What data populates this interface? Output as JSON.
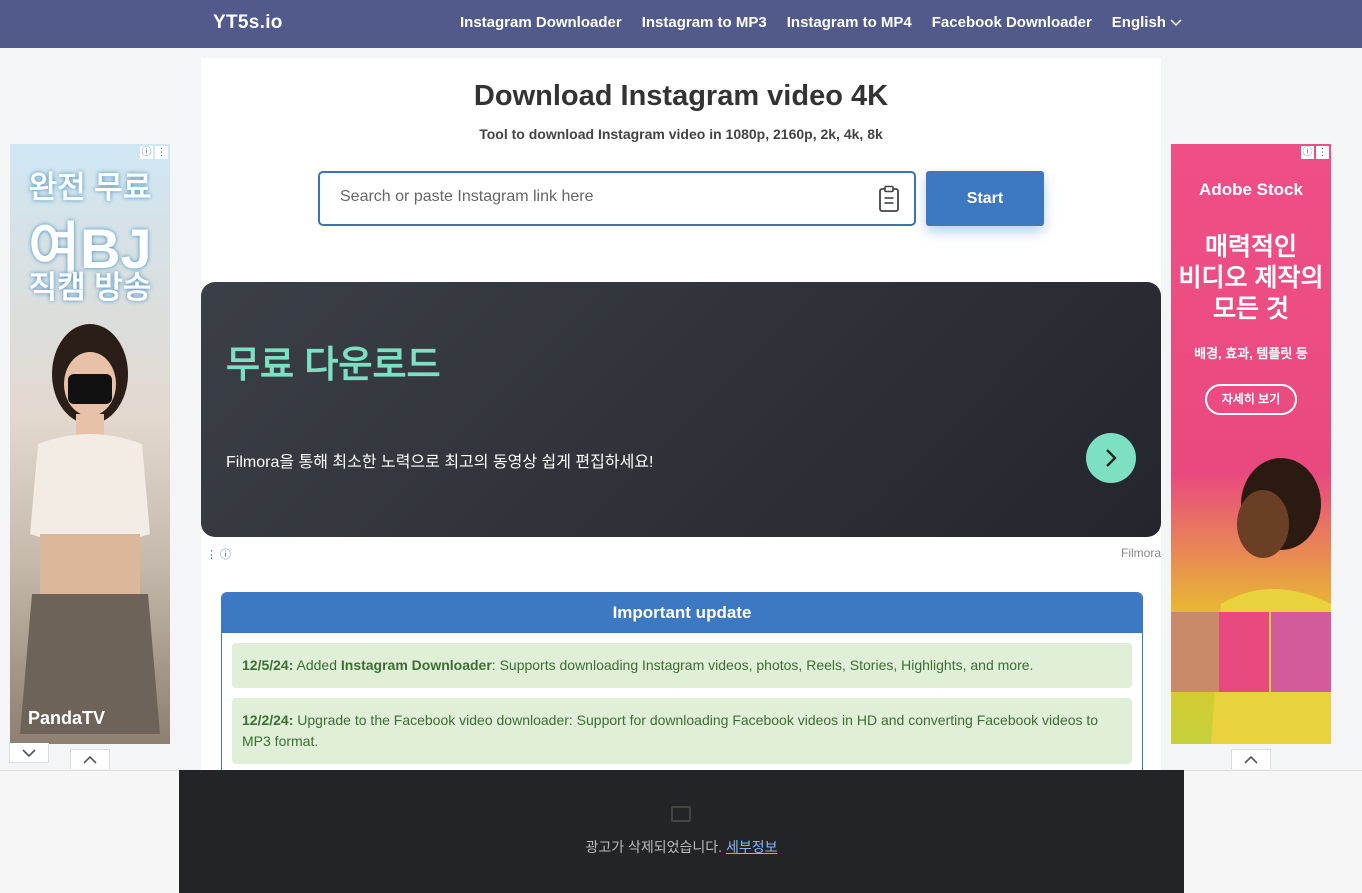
{
  "nav": {
    "logo": "YT5s.io",
    "links": [
      "Instagram Downloader",
      "Instagram to MP3",
      "Instagram to MP4",
      "Facebook Downloader"
    ],
    "language": "English"
  },
  "hero": {
    "title": "Download Instagram video 4K",
    "subtitle": "Tool to download Instagram video in 1080p, 2160p, 2k, 4k, 8k"
  },
  "search": {
    "placeholder": "Search or paste Instagram link here",
    "value": "",
    "button_label": "Start"
  },
  "inline_ad": {
    "headline": "무료 다운로드",
    "text": "Filmora을 통해 최소한 노력으로 최고의 동영상 쉽게 편집하세요!",
    "brand": "Filmora"
  },
  "updates": {
    "header": "Important update",
    "items": [
      {
        "date": "12/5/24:",
        "prefix": " Added ",
        "bold": "Instagram Downloader",
        "text": ": Supports downloading Instagram videos, photos, Reels, Stories, Highlights, and more."
      },
      {
        "date": "12/2/24:",
        "prefix": " Upgrade to the Facebook video downloader: Support for downloading Facebook videos in HD and converting Facebook videos to MP3 format.",
        "bold": "",
        "text": ""
      }
    ]
  },
  "left_ad": {
    "line1": "완전 무료",
    "line2": "여BJ",
    "line3": "직캠 방송",
    "brand": "PandaTV"
  },
  "right_ad": {
    "brand": "Adobe Stock",
    "headline_1": "매력적인",
    "headline_2": "비디오 제작의",
    "headline_3": "모든 것",
    "sub": "배경, 효과, 템플릿 등",
    "cta": "자세히 보기"
  },
  "bottom_ad": {
    "removed_text": "광고가 삭제되었습니다.",
    "details_link": "세부정보"
  },
  "colors": {
    "nav_bg": "#515a8a",
    "accent": "#3d78c3",
    "ad_green": "#7ee0c3",
    "update_bg": "#e0efd8",
    "update_text": "#3c6e32"
  }
}
